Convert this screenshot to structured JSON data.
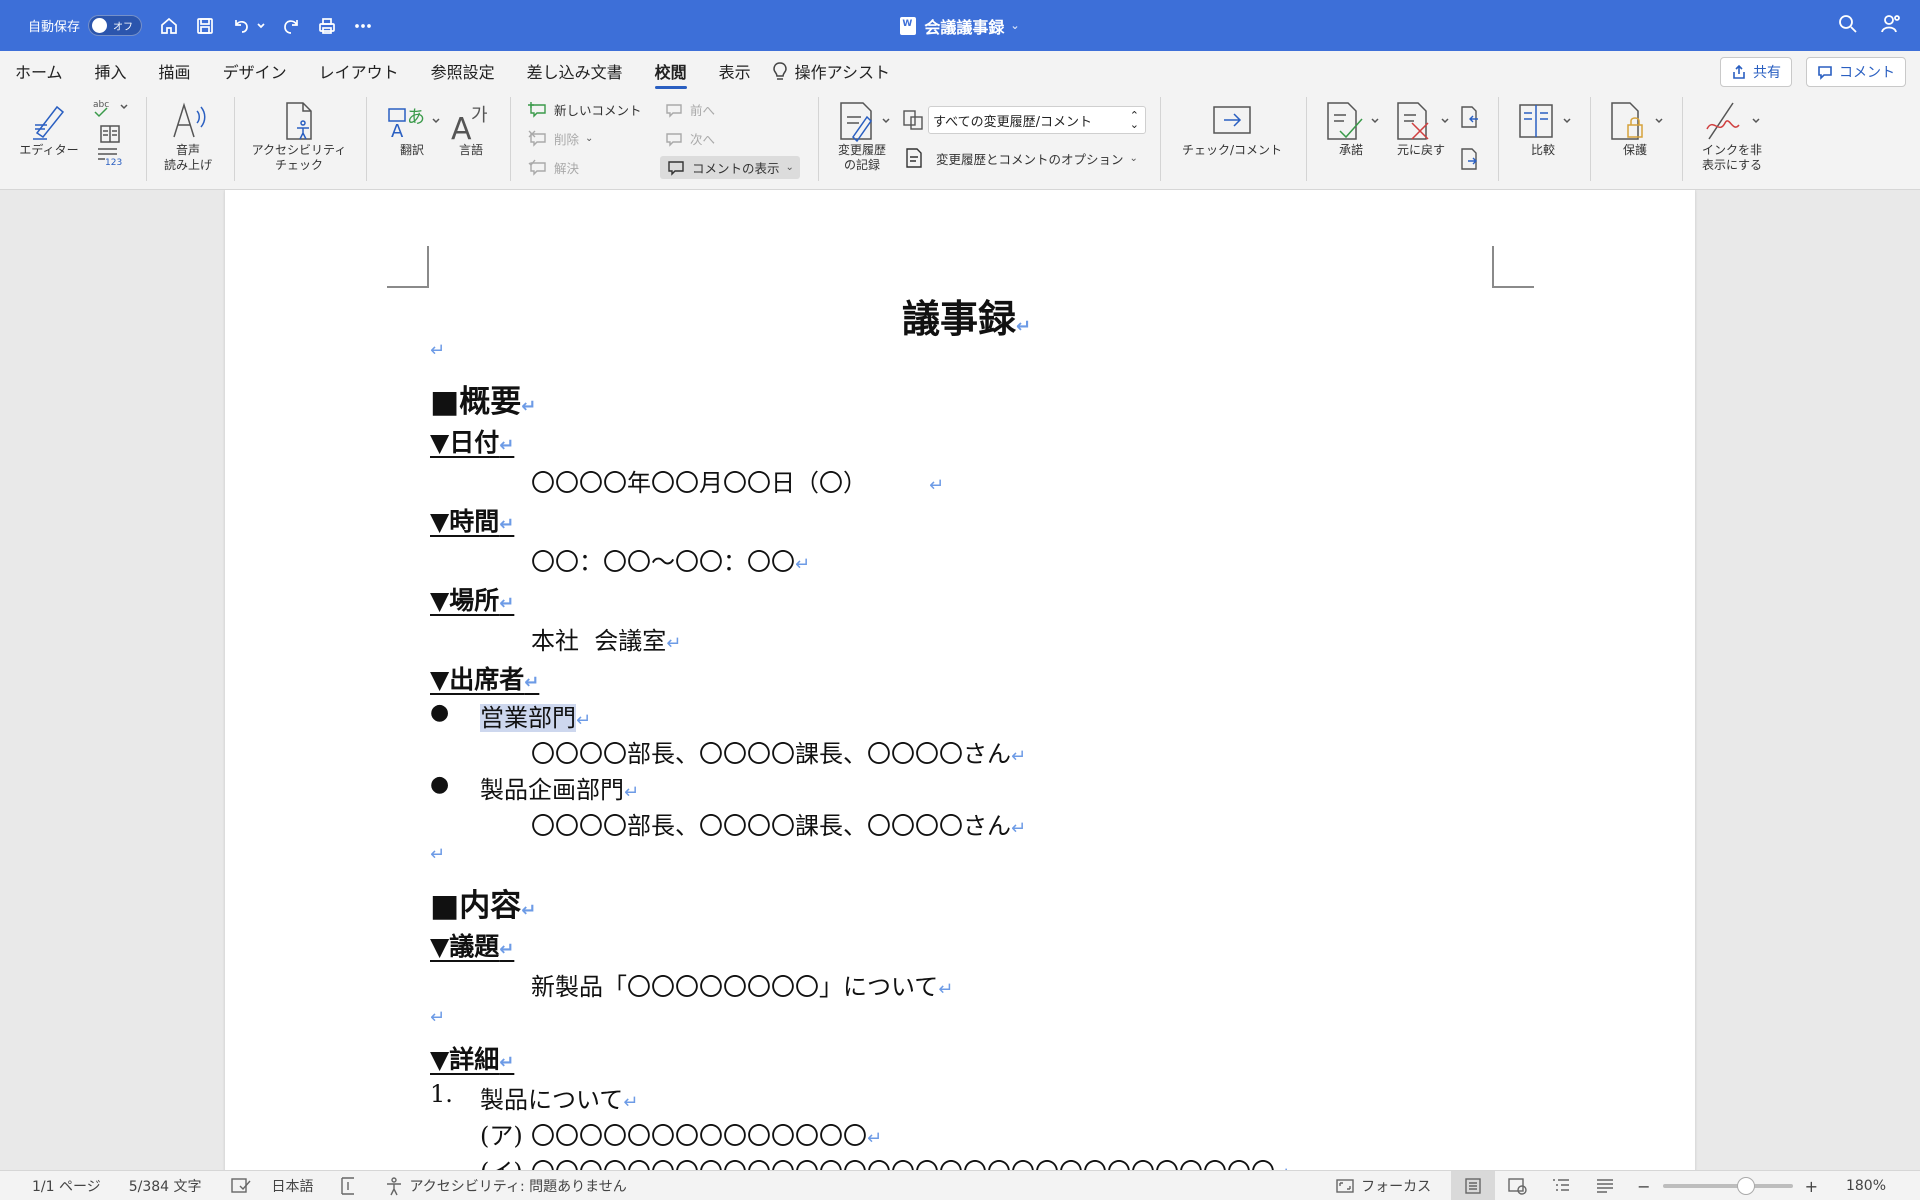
{
  "titlebar": {
    "autosave_label": "自動保存",
    "toggle_label": "オフ",
    "doc_title": "会議議事録"
  },
  "menu": {
    "tabs": [
      "ホーム",
      "挿入",
      "描画",
      "デザイン",
      "レイアウト",
      "参照設定",
      "差し込み文書",
      "校閲",
      "表示"
    ],
    "active_tab": "校閲",
    "tell_me": "操作アシスト",
    "share": "共有",
    "comments": "コメント"
  },
  "ribbon": {
    "editor": "エディター",
    "read_aloud_1": "音声",
    "read_aloud_2": "読み上げ",
    "accessibility_1": "アクセシビリティ",
    "accessibility_2": "チェック",
    "translate": "翻訳",
    "language": "言語",
    "new_comment": "新しいコメント",
    "delete": "削除",
    "resolve": "解決",
    "previous": "前へ",
    "next": "次へ",
    "show_comments": "コメントの表示",
    "track_changes_1": "変更履歴",
    "track_changes_2": "の記録",
    "markup_select": "すべての変更履歴/コメント",
    "markup_options": "変更履歴とコメントのオプション",
    "check_comment": "チェック/コメント",
    "accept": "承諾",
    "reject": "元に戻す",
    "compare": "比較",
    "protect": "保護",
    "hide_ink_1": "インクを非",
    "hide_ink_2": "表示にする"
  },
  "document": {
    "title": "議事録",
    "overview": "■概要",
    "date_h": "▼日付",
    "date_v": "〇〇〇〇年〇〇月〇〇日（〇）",
    "time_h": "▼時間",
    "time_v": "〇〇：〇〇～〇〇：〇〇",
    "place_h": "▼場所",
    "place_v": "本社  会議室",
    "attendees_h": "▼出席者",
    "bullet": "●",
    "dept1": "営業部門",
    "dept1_members": "〇〇〇〇部長、〇〇〇〇課長、〇〇〇〇さん",
    "dept2": "製品企画部門",
    "dept2_members": "〇〇〇〇部長、〇〇〇〇課長、〇〇〇〇さん",
    "content": "■内容",
    "agenda_h": "▼議題",
    "agenda_v": "新製品「〇〇〇〇〇〇〇〇」について",
    "details_h": "▼詳細",
    "item1_num": "1.",
    "item1": "製品について",
    "sub_a_num": "(ア)",
    "sub_a": "〇〇〇〇〇〇〇〇〇〇〇〇〇〇",
    "sub_b_num": "(イ)",
    "sub_b": "〇〇〇〇〇〇〇〇〇〇〇〇〇〇〇〇〇〇〇〇〇〇〇〇〇〇〇〇〇〇〇",
    "return_mark": "↵"
  },
  "status": {
    "page": "1/1 ページ",
    "words": "5/384 文字",
    "language": "日本語",
    "accessibility": "アクセシビリティ: 問題ありません",
    "focus": "フォーカス",
    "zoom": "180%",
    "zoom_minus": "−",
    "zoom_plus": "+"
  }
}
